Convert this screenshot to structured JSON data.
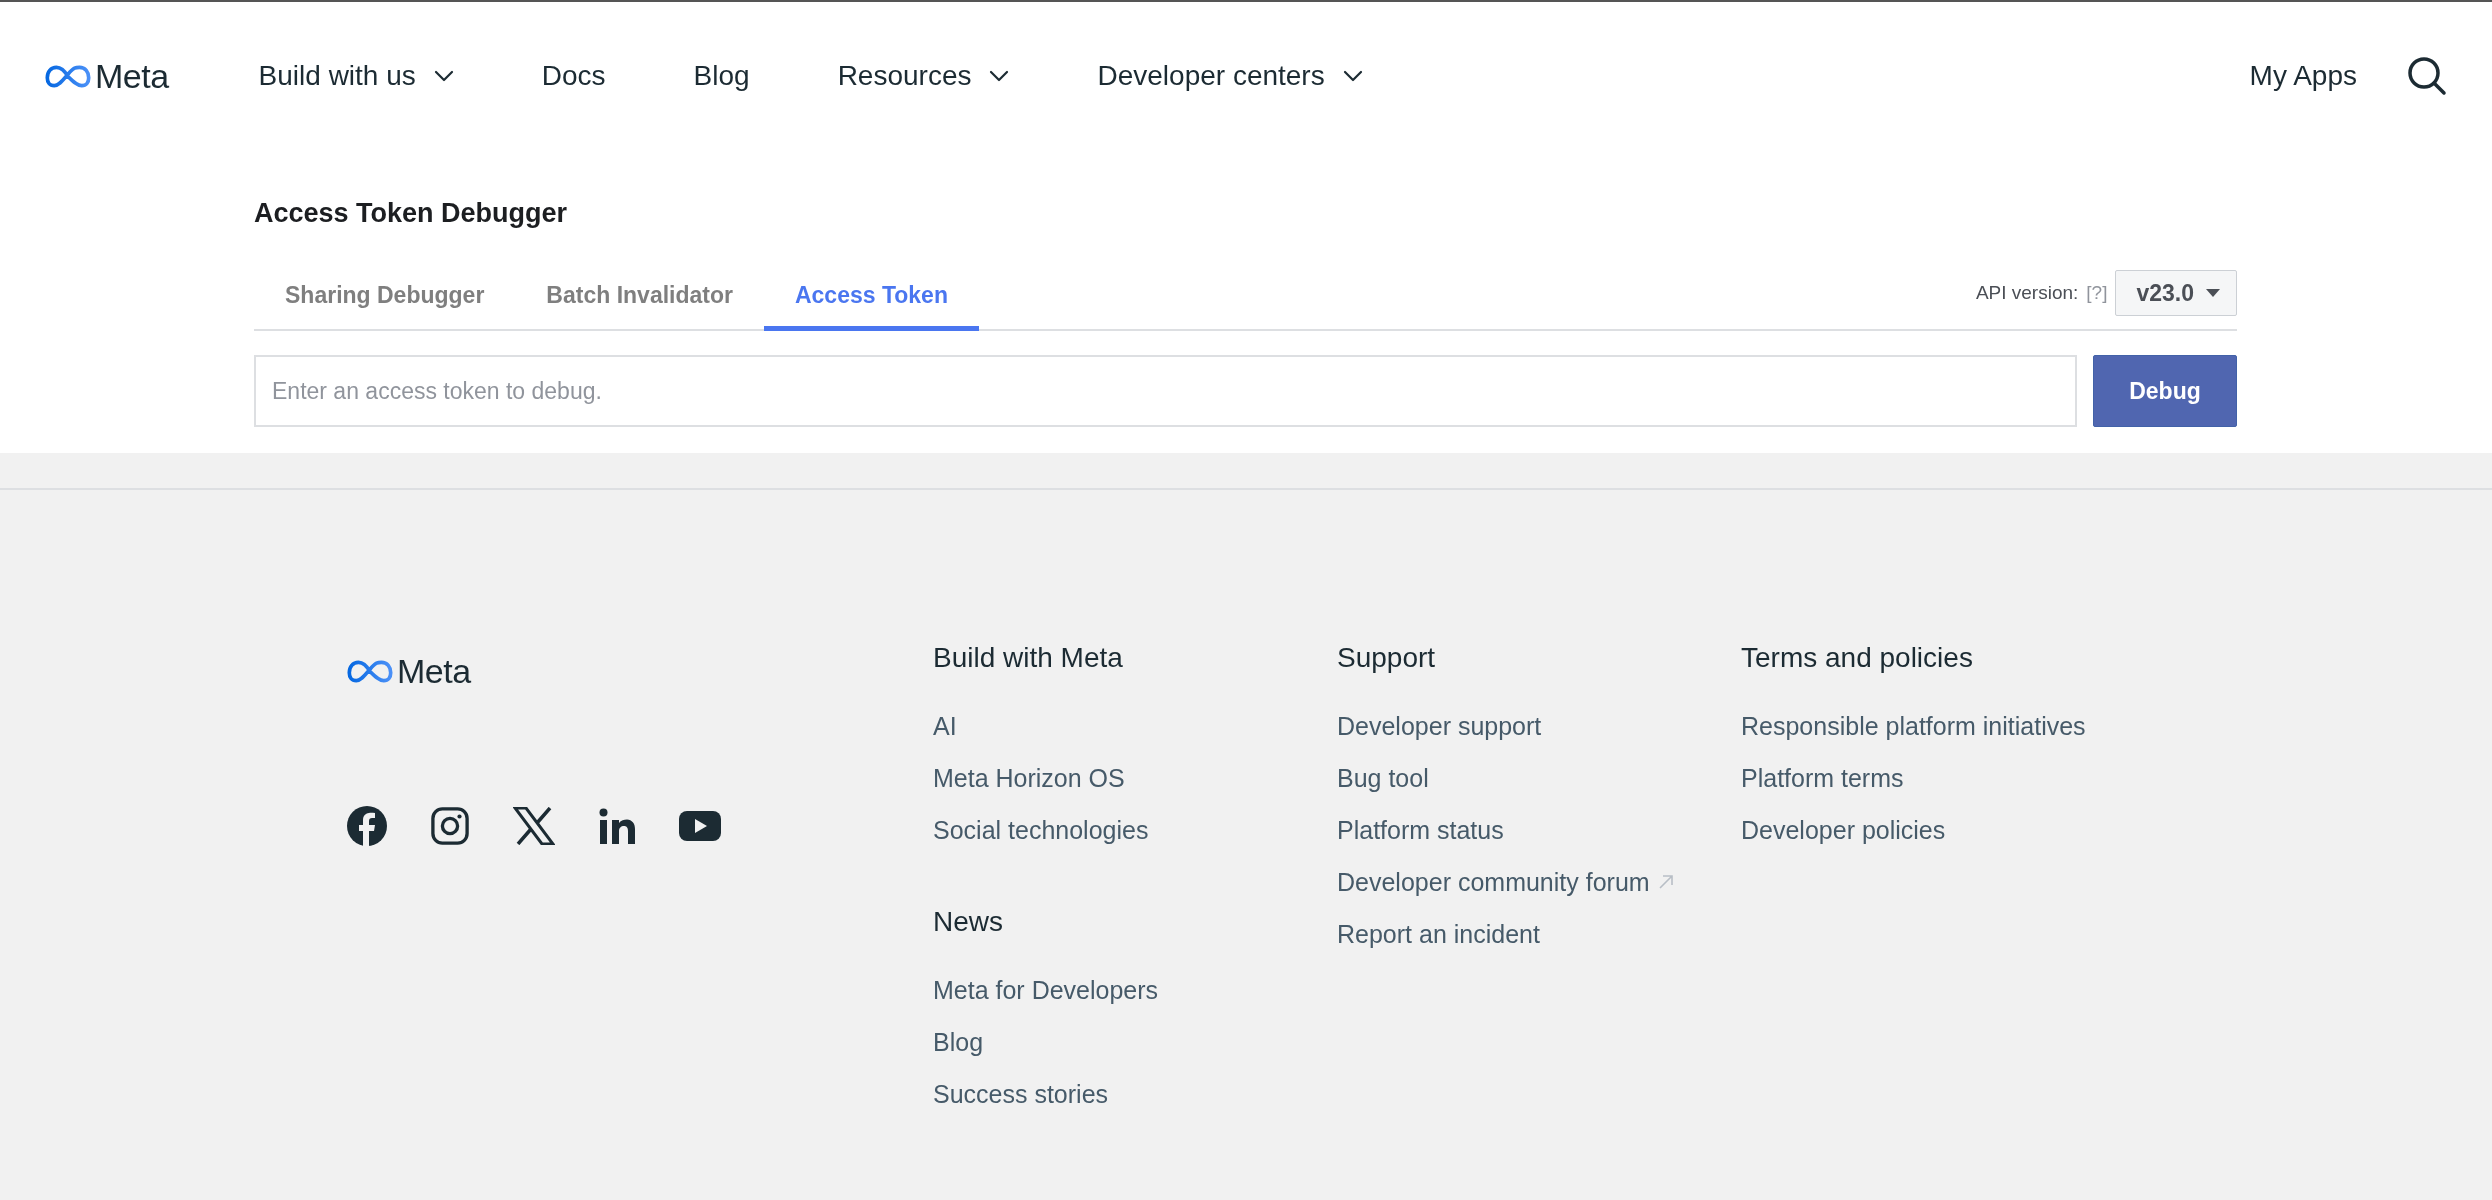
{
  "header": {
    "logo": "Meta",
    "nav": [
      {
        "label": "Build with us",
        "dropdown": true
      },
      {
        "label": "Docs",
        "dropdown": false
      },
      {
        "label": "Blog",
        "dropdown": false
      },
      {
        "label": "Resources",
        "dropdown": true
      },
      {
        "label": "Developer centers",
        "dropdown": true
      }
    ],
    "my_apps": "My Apps"
  },
  "tool": {
    "title": "Access Token Debugger",
    "tabs": [
      {
        "label": "Sharing Debugger",
        "selected": false
      },
      {
        "label": "Batch Invalidator",
        "selected": false
      },
      {
        "label": "Access Token",
        "selected": true
      }
    ],
    "api_version_label": "API version:",
    "api_help": "[?]",
    "api_version": "v23.0",
    "token_field": {
      "placeholder": "Enter an access token to debug."
    },
    "debug_button": "Debug"
  },
  "footer": {
    "logo": "Meta",
    "columns": [
      {
        "sections": [
          {
            "heading": "Build with Meta",
            "links": [
              {
                "label": "AI",
                "external": false
              },
              {
                "label": "Meta Horizon OS",
                "external": false
              },
              {
                "label": "Social technologies",
                "external": false
              }
            ]
          },
          {
            "heading": "News",
            "links": [
              {
                "label": "Meta for Developers",
                "external": false
              },
              {
                "label": "Blog",
                "external": false
              },
              {
                "label": "Success stories",
                "external": false
              }
            ]
          }
        ]
      },
      {
        "sections": [
          {
            "heading": "Support",
            "links": [
              {
                "label": "Developer support",
                "external": false
              },
              {
                "label": "Bug tool",
                "external": false
              },
              {
                "label": "Platform status",
                "external": false
              },
              {
                "label": "Developer community forum",
                "external": true
              },
              {
                "label": "Report an incident",
                "external": false
              }
            ]
          }
        ]
      },
      {
        "sections": [
          {
            "heading": "Terms and policies",
            "links": [
              {
                "label": "Responsible platform initiatives",
                "external": false
              },
              {
                "label": "Platform terms",
                "external": false
              },
              {
                "label": "Developer policies",
                "external": false
              }
            ]
          }
        ]
      }
    ]
  }
}
